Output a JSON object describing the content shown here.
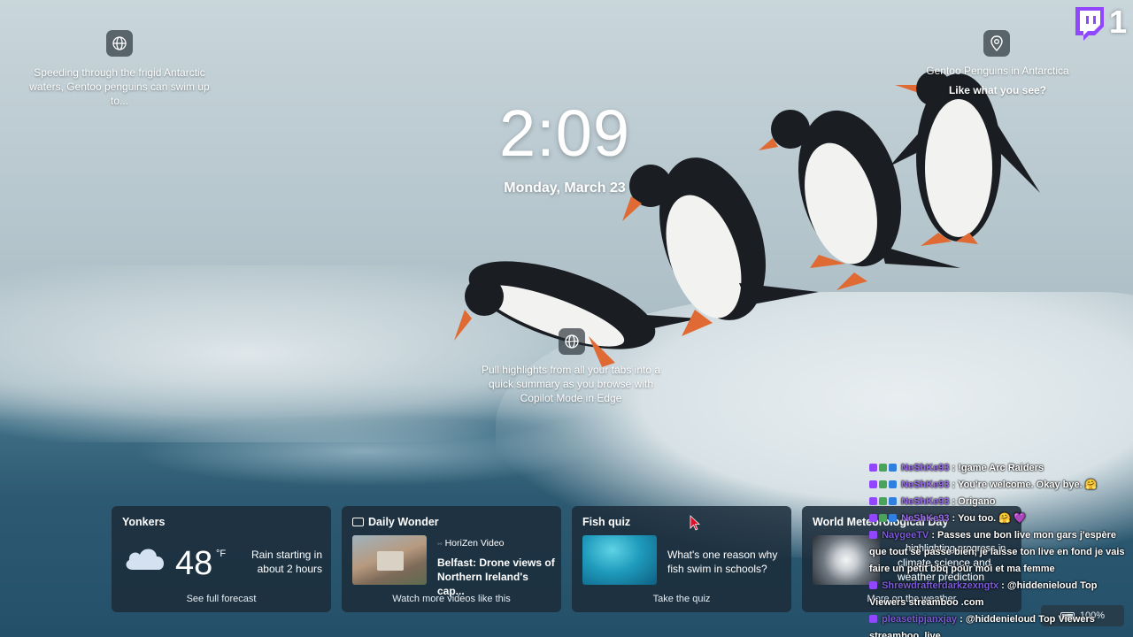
{
  "colors": {
    "twitch": "#9146ff",
    "card_bg": "#1c2c3a",
    "cursor": "#e0102a"
  },
  "clock": {
    "time": "2:09",
    "date": "Monday, March 23"
  },
  "tips": {
    "top_left": "Speeding through the frigid Antarctic waters, Gentoo penguins can swim up to...",
    "top_right_title": "Gentoo Penguins in Antarctica",
    "top_right_sub": "Like what you see?",
    "center": "Pull highlights from all your tabs into a quick summary as you browse with Copilot Mode in Edge"
  },
  "icons": {
    "globe": "globe-icon",
    "location": "location-pin-icon",
    "twitch": "twitch-logo"
  },
  "twitch": {
    "viewer_count": "1"
  },
  "cards": {
    "weather": {
      "title": "Yonkers",
      "temp": "48",
      "unit": "°F",
      "forecast": "Rain starting in about 2 hours",
      "footer": "See full forecast"
    },
    "daily_wonder": {
      "title": "Daily Wonder",
      "source": "HoriZen Video",
      "headline": "Belfast: Drone views of Northern Ireland's cap...",
      "footer": "Watch more videos like this"
    },
    "fish_quiz": {
      "title": "Fish quiz",
      "question": "What's one reason why fish swim in schools?",
      "footer": "Take the quiz"
    },
    "met_day": {
      "title": "World Meteorological Day",
      "text_a": "...highlighting progress in",
      "text_b": "climate science and",
      "text_c": "weather prediction",
      "footer": "More on the weather"
    }
  },
  "chat": [
    {
      "user": "NeShKe93",
      "sep": " : ",
      "msg": "!game Arc Raiders"
    },
    {
      "user": "NeShKe93",
      "sep": " : ",
      "msg": "You're welcome. Okay bye. 🤗"
    },
    {
      "user": "NeShKe93",
      "sep": " : ",
      "msg": "Origano"
    },
    {
      "user": "NeShKe93",
      "sep": " : ",
      "msg": "You too. 🤗 💜"
    },
    {
      "user": "NaygeeTV",
      "sep": " : ",
      "msg": "Passes une bon live mon gars j'espère"
    },
    {
      "user": "",
      "sep": "",
      "msg": "que tout se passe bien, je laisse ton live en fond je vais"
    },
    {
      "user": "",
      "sep": "",
      "msg": "faire un petit bbq pour moi et ma femme"
    },
    {
      "user": "Shrewdrafterdarkzexngtx",
      "sep": " : ",
      "msg": "@hiddenieloud Top"
    },
    {
      "user": "",
      "sep": "",
      "msg": "Viewers streamboo .com"
    },
    {
      "user": "pleasetipjanxjay",
      "sep": " : ",
      "msg": "@hiddenieloud Top Viewers"
    },
    {
      "user": "",
      "sep": "",
      "msg": "streamboo .live"
    }
  ],
  "system": {
    "battery": "100%"
  }
}
